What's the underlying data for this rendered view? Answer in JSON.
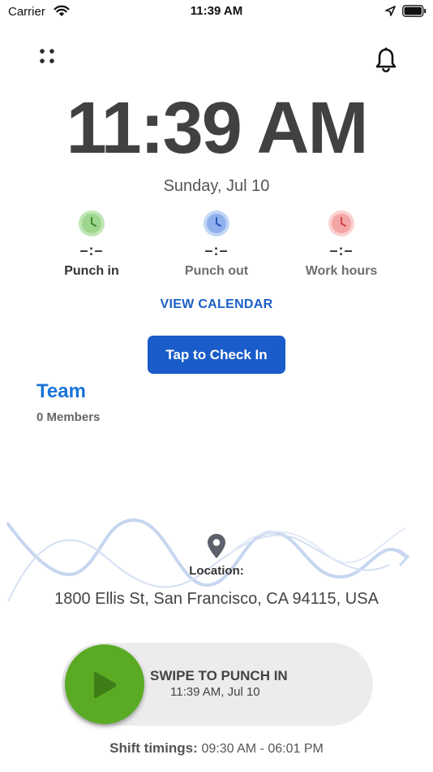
{
  "status_bar": {
    "carrier": "Carrier",
    "time": "11:39 AM"
  },
  "clock": {
    "time": "11:39 AM",
    "date": "Sunday, Jul 10"
  },
  "stats": [
    {
      "value": "–:–",
      "label": "Punch in",
      "icon": "clock-green-icon",
      "color": "#7cc66b"
    },
    {
      "value": "–:–",
      "label": "Punch out",
      "icon": "clock-blue-icon",
      "color": "#5d8fe0"
    },
    {
      "value": "–:–",
      "label": "Work hours",
      "icon": "clock-red-icon",
      "color": "#ee7c7c"
    }
  ],
  "view_calendar": "VIEW CALENDAR",
  "checkin_button": "Tap to Check In",
  "team": {
    "title": "Team",
    "members": "0 Members"
  },
  "location": {
    "label": "Location:",
    "address": "1800 Ellis St, San Francisco, CA 94115, USA"
  },
  "swipe": {
    "title": "SWIPE TO PUNCH IN",
    "subtitle": "11:39 AM, Jul 10"
  },
  "shift": {
    "label": "Shift timings:",
    "value": "09:30 AM - 06:01 PM"
  },
  "colors": {
    "primary": "#1a5cc9",
    "team": "#1a73d8",
    "swipe_green": "#5aab23"
  }
}
